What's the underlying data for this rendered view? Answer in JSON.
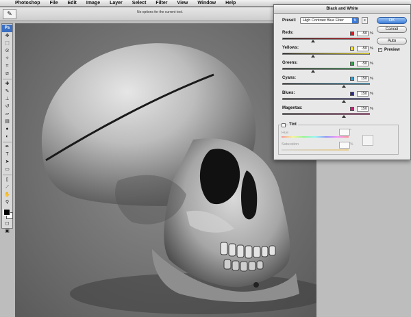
{
  "menubar": {
    "app": "Photoshop",
    "items": [
      "File",
      "Edit",
      "Image",
      "Layer",
      "Select",
      "Filter",
      "View",
      "Window",
      "Help"
    ]
  },
  "options_bar": {
    "message": "No options for the current tool."
  },
  "toolbox": {
    "logo": "Ps"
  },
  "dialog": {
    "title": "Black and White",
    "preset_label": "Preset:",
    "preset_value": "High Contrast Blue Filter",
    "ok_label": "OK",
    "cancel_label": "Cancel",
    "auto_label": "Auto",
    "preview_label": "Preview",
    "preview_checked": true,
    "channels": [
      {
        "label": "Reds:",
        "value": "-50",
        "color": "#e3161e",
        "level": 0.35
      },
      {
        "label": "Yellows:",
        "value": "-50",
        "color": "#ffe81a",
        "level": 0.35
      },
      {
        "label": "Greens:",
        "value": "-50",
        "color": "#2aa84a",
        "level": 0.35
      },
      {
        "label": "Cyans:",
        "value": "150",
        "color": "#28a6dc",
        "level": 0.7
      },
      {
        "label": "Blues:",
        "value": "150",
        "color": "#2a2890",
        "level": 0.7
      },
      {
        "label": "Magentas:",
        "value": "150",
        "color": "#d81a7c",
        "level": 0.7
      }
    ],
    "pct": "%",
    "tint_label": "Tint",
    "tint_checked": false,
    "hue_label": "Hue",
    "hue_unit": "°",
    "saturation_label": "Saturation",
    "saturation_unit": "%"
  }
}
